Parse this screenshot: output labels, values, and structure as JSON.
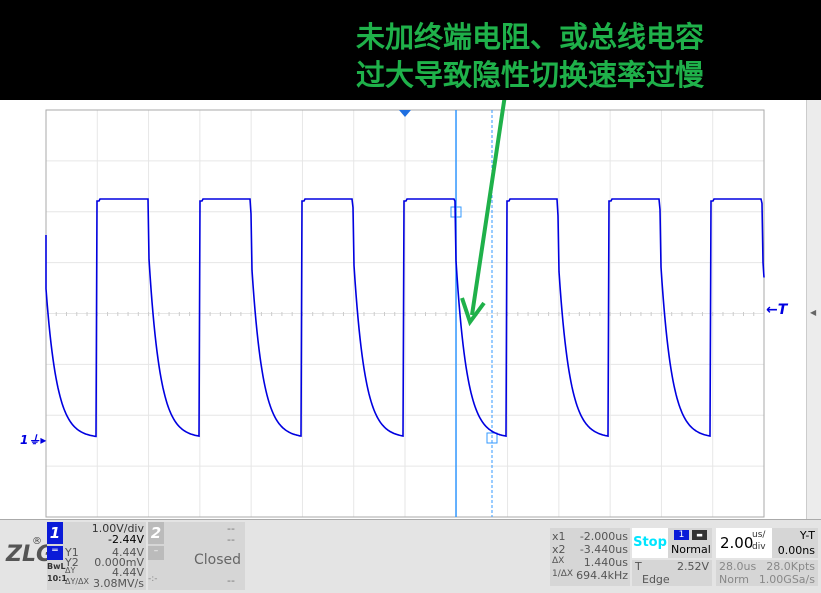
{
  "annotation": {
    "line1": "未加终端电阻、或总线电容",
    "line2": "过大导致隐性切换速率过慢"
  },
  "markers": {
    "ch1": "1",
    "trigger": "T"
  },
  "ch1": {
    "number": "1",
    "scale": "1.00V/div",
    "offset": "-2.44V",
    "coupling": "BwL",
    "probe": "10:1",
    "y1_label": "Y1",
    "y1": "4.44V",
    "y2_label": "Y2",
    "y2": "0.000mV",
    "dy_label": "ΔY",
    "dy": "4.44V",
    "dydx_label": "ΔY/ΔX",
    "dydx": "3.08MV/s"
  },
  "ch2": {
    "number": "2",
    "scale": "--",
    "offset": "--",
    "status": "Closed",
    "val": "--",
    "dash": "-:-"
  },
  "cursor": {
    "x1_label": "x1",
    "x1": "-2.000us",
    "x2_label": "x2",
    "x2": "-3.440us",
    "dx_label": "ΔX",
    "dx": "1.440us",
    "inv_label": "1/ΔX",
    "inv": "694.4kHz"
  },
  "acq": {
    "state": "Stop",
    "trig_src": "1",
    "mode": "Normal",
    "trig_label": "T",
    "trig_level": "2.52V",
    "trig_type": "Edge"
  },
  "timebase": {
    "value": "2.00",
    "unit_top": "us/",
    "unit_bottom": "div",
    "mode": "Y-T",
    "delay": "0.00ns",
    "window": "28.0us",
    "points": "28.0Kpts",
    "acq_mode": "Norm",
    "rate": "1.00GSa/s"
  },
  "logo": "ZLG",
  "colors": {
    "trace": "#0000e0",
    "cursor": "#3399ff",
    "annotation": "#1fb14a",
    "stop": "#00e5ff"
  }
}
